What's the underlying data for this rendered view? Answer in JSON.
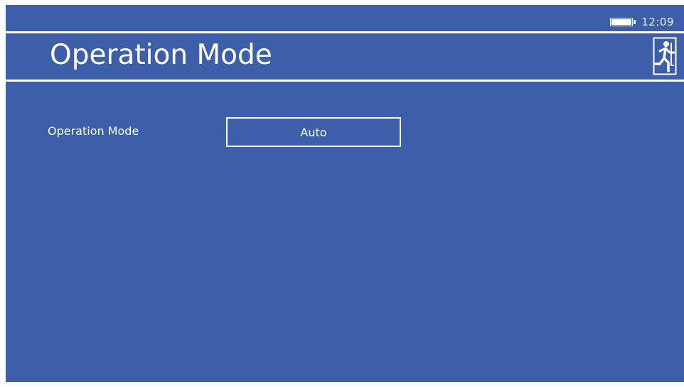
{
  "status": {
    "time": "12:09",
    "battery_level": 1.0
  },
  "header": {
    "title": "Operation Mode",
    "exit_icon": "exit-running-man-icon"
  },
  "settings": {
    "operation_mode": {
      "label": "Operation Mode",
      "value": "Auto"
    }
  },
  "colors": {
    "background": "#3d5faa",
    "foreground": "#ffffff"
  }
}
